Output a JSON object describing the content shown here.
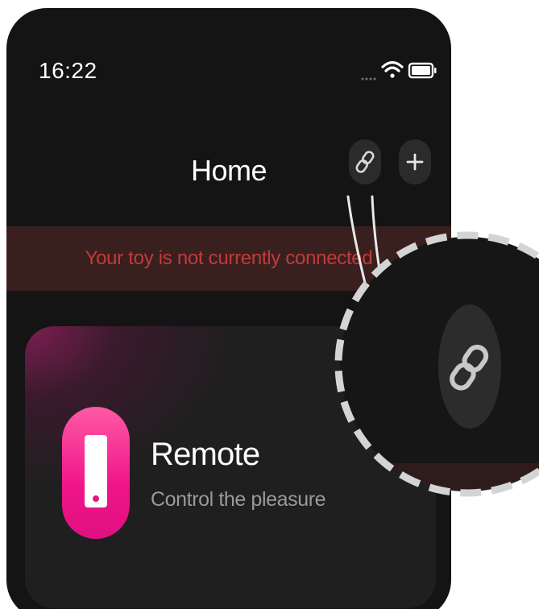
{
  "status_bar": {
    "time": "16:22",
    "icons": [
      "signal-dots-icon",
      "wifi-icon",
      "battery-icon"
    ]
  },
  "header": {
    "title": "Home",
    "link_button_icon": "link-icon",
    "add_button_icon": "plus-icon"
  },
  "banner": {
    "text": "Your toy is not currently connected",
    "color": "#c23b3b",
    "background": "#3a1f1f"
  },
  "card": {
    "title": "Remote",
    "subtitle": "Control the pleasure",
    "icon": "remote-icon",
    "accent": "#f0148a"
  },
  "callout": {
    "icon": "link-icon",
    "arrow_icon": "arrow-down-left-icon"
  }
}
